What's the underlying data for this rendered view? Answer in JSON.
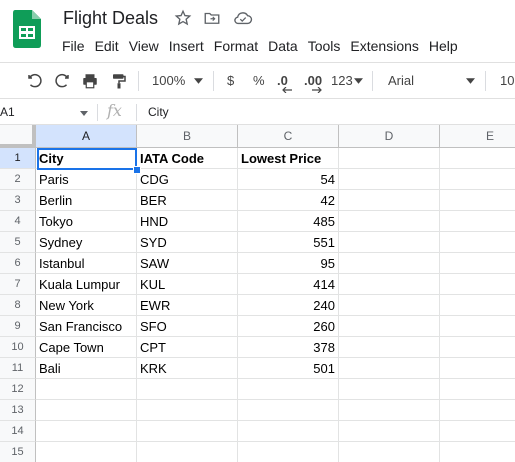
{
  "document": {
    "title": "Flight Deals"
  },
  "menu": [
    "File",
    "Edit",
    "View",
    "Insert",
    "Format",
    "Data",
    "Tools",
    "Extensions",
    "Help"
  ],
  "toolbar": {
    "zoom": "100%",
    "currency": "$",
    "percent": "%",
    "decrease_decimal": ".0",
    "increase_decimal": ".00",
    "more_formats": "123",
    "font": "Arial",
    "font_size": "10"
  },
  "formula_bar": {
    "cell_ref": "A1",
    "fx": "fx",
    "value": "City"
  },
  "columns": [
    "A",
    "B",
    "C",
    "D",
    "E"
  ],
  "rows": [
    "1",
    "2",
    "3",
    "4",
    "5",
    "6",
    "7",
    "8",
    "9",
    "10",
    "11",
    "12",
    "13",
    "14",
    "15"
  ],
  "table": {
    "header": [
      "City",
      "IATA Code",
      "Lowest Price"
    ],
    "data": [
      [
        "Paris",
        "CDG",
        "54"
      ],
      [
        "Berlin",
        "BER",
        "42"
      ],
      [
        "Tokyo",
        "HND",
        "485"
      ],
      [
        "Sydney",
        "SYD",
        "551"
      ],
      [
        "Istanbul",
        "SAW",
        "95"
      ],
      [
        "Kuala Lumpur",
        "KUL",
        "414"
      ],
      [
        "New York",
        "EWR",
        "240"
      ],
      [
        "San Francisco",
        "SFO",
        "260"
      ],
      [
        "Cape Town",
        "CPT",
        "378"
      ],
      [
        "Bali",
        "KRK",
        "501"
      ]
    ]
  },
  "colors": {
    "accent": "#1a73e8",
    "sheets_green": "#0f9d58",
    "header_bg": "#f8f9fa",
    "selected_header": "#d3e3fd"
  }
}
